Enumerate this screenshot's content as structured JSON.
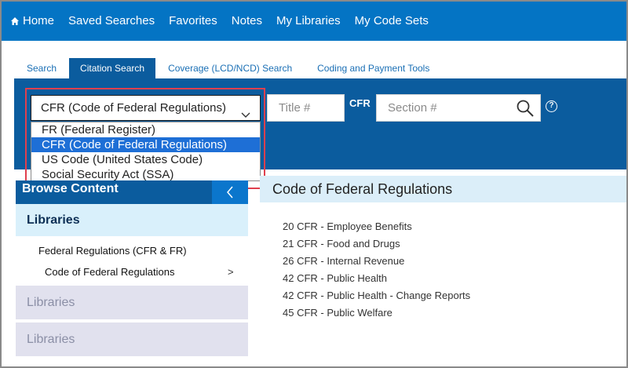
{
  "nav": {
    "items": [
      {
        "label": "Home",
        "icon": "home-icon"
      },
      {
        "label": "Saved Searches"
      },
      {
        "label": "Favorites"
      },
      {
        "label": "Notes"
      },
      {
        "label": "My Libraries"
      },
      {
        "label": "My Code Sets"
      }
    ]
  },
  "tabs": [
    {
      "label": "Search"
    },
    {
      "label": "Citation Search",
      "active": true
    },
    {
      "label": "Coverage (LCD/NCD) Search"
    },
    {
      "label": "Coding and Payment Tools"
    }
  ],
  "search": {
    "select_value": "CFR (Code of Federal Regulations)",
    "title_placeholder": "Title #",
    "cfr_label": "CFR",
    "section_placeholder": "Section #",
    "help_label": "?",
    "options": [
      {
        "label": "FR (Federal Register)"
      },
      {
        "label": "CFR (Code of Federal Regulations)",
        "selected": true
      },
      {
        "label": "US Code (United States Code)"
      },
      {
        "label": "Social Security Act (SSA)"
      }
    ]
  },
  "left": {
    "browse_header": "Browse Content",
    "libraries_header": "Libraries",
    "tree": {
      "parent": "Federal Regulations (CFR & FR)",
      "child": "Code of Federal Regulations",
      "child_arrow": ">"
    },
    "collapsed": [
      "Libraries",
      "Libraries"
    ]
  },
  "content": {
    "title": "Code of Federal Regulations",
    "items": [
      "20 CFR - Employee Benefits",
      "21 CFR - Food and Drugs",
      "26 CFR - Internal Revenue",
      "42 CFR - Public Health",
      "42 CFR - Public Health - Change Reports",
      "45 CFR - Public Welfare"
    ]
  },
  "colors": {
    "nav_bg": "#0474c4",
    "band_bg": "#0b5c9e",
    "selected_option": "#1e6fd6",
    "highlight_outline": "#e0404e"
  }
}
